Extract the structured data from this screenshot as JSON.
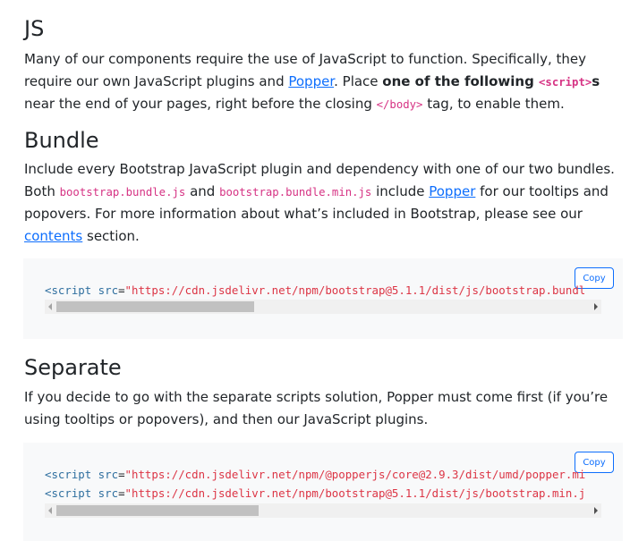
{
  "js": {
    "title": "JS",
    "p1": "Many of our components require the use of JavaScript to function. Specifically, they require our own JavaScript plugins and ",
    "popper_link": "Popper",
    "p2": ". Place ",
    "bold": "one of the following ",
    "code_script": "<script>",
    "bold_s": "s",
    "p3": " near the end of your pages, right before the closing ",
    "code_body": "</body>",
    "p4": " tag, to enable them."
  },
  "bundle": {
    "title": "Bundle",
    "p1": "Include every Bootstrap JavaScript plugin and dependency with one of our two bundles. Both ",
    "code1": "bootstrap.bundle.js",
    "and": " and ",
    "code2": "bootstrap.bundle.min.js",
    "p2": " include ",
    "popper_link": "Popper",
    "p3": " for our tooltips and popovers. For more information about what’s included in Bootstrap, please see our ",
    "contents_link": "contents",
    "p4": " section.",
    "copy_label": "Copy",
    "code": {
      "tag": "<script",
      "attr": " src",
      "eq": "=",
      "str": "\"https://cdn.jsdelivr.net/npm/bootstrap@5.1.1/dist/js/bootstrap.bundl"
    },
    "scroll_fraction": 0.37
  },
  "separate": {
    "title": "Separate",
    "p": "If you decide to go with the separate scripts solution, Popper must come first (if you’re using tooltips or popovers), and then our JavaScript plugins.",
    "copy_label": "Copy",
    "code": [
      {
        "tag": "<script",
        "attr": " src",
        "eq": "=",
        "str": "\"https://cdn.jsdelivr.net/npm/@popperjs/core@2.9.3/dist/umd/popper.mi"
      },
      {
        "tag": "<script",
        "attr": " src",
        "eq": "=",
        "str": "\"https://cdn.jsdelivr.net/npm/bootstrap@5.1.1/dist/js/bootstrap.min.j"
      }
    ],
    "scroll_fraction": 0.38
  }
}
